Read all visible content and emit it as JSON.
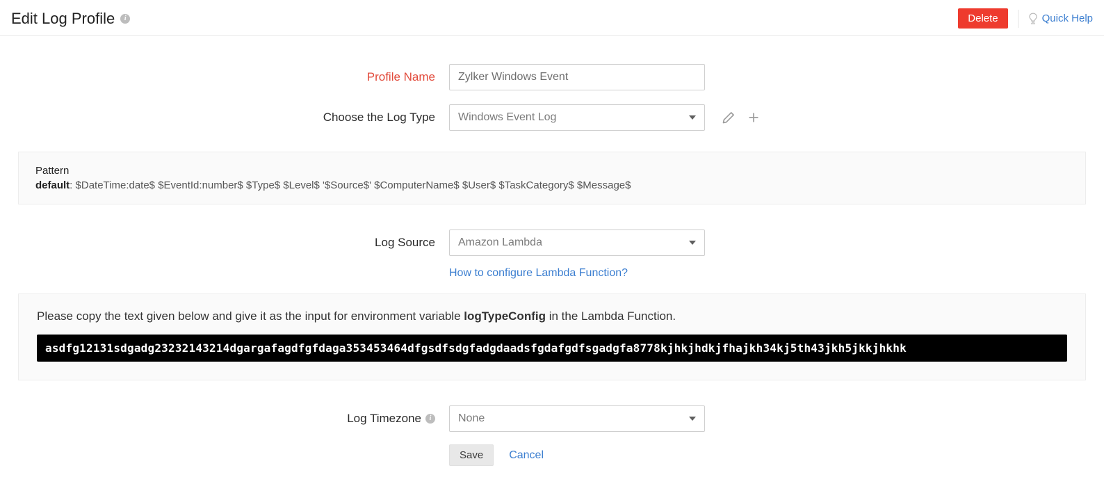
{
  "header": {
    "title": "Edit Log Profile",
    "delete_label": "Delete",
    "quick_help_label": "Quick Help"
  },
  "form": {
    "profile_name_label": "Profile Name",
    "profile_name_value": "Zylker Windows Event",
    "log_type_label": "Choose the Log Type",
    "log_type_value": "Windows Event Log",
    "log_source_label": "Log Source",
    "log_source_value": "Amazon Lambda",
    "log_timezone_label": "Log Timezone",
    "log_timezone_value": "None",
    "save_label": "Save",
    "cancel_label": "Cancel"
  },
  "pattern": {
    "title": "Pattern",
    "name": "default",
    "separator": ": ",
    "expr": "$DateTime:date$ $EventId:number$ $Type$ $Level$ '$Source$' $ComputerName$ $User$ $TaskCategory$ $Message$"
  },
  "lambda": {
    "help_link": "How to configure Lambda Function?",
    "instruction_prefix": "Please copy the text given below and give it as the input for environment variable ",
    "instruction_var": "logTypeConfig",
    "instruction_suffix": " in the Lambda Function.",
    "config_value": "asdfg12131sdgadg23232143214dgargafagdfgfdaga353453464dfgsdfsdgfadgdaadsfgdafgdfsgadgfa8778kjhkjhdkjfhajkh34kj5th43jkh5jkkjhkhk"
  }
}
